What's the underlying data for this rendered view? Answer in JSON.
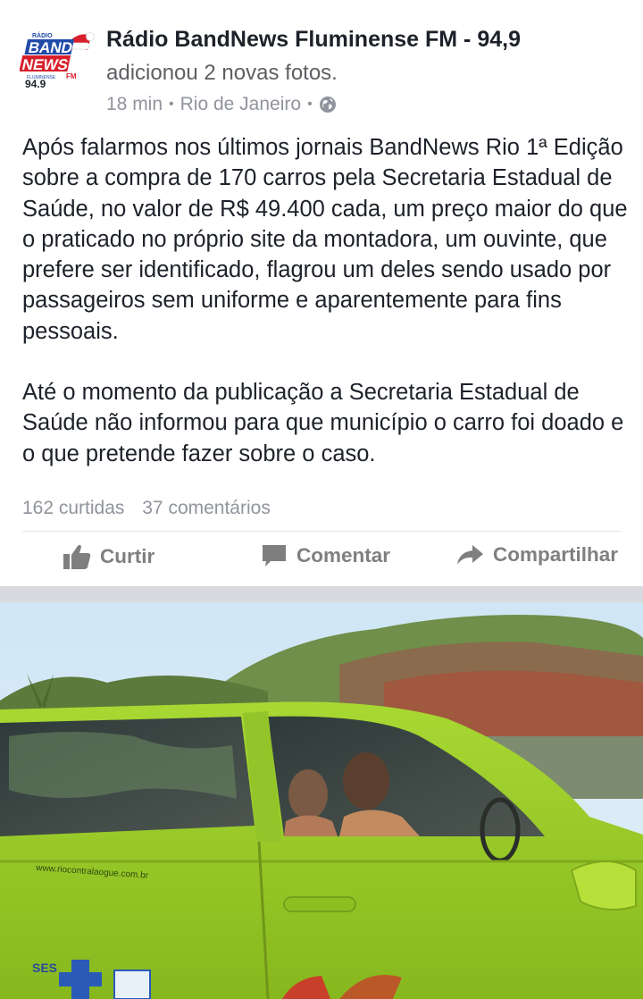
{
  "post": {
    "logo": {
      "small_text": "RÁDIO",
      "line1": "BAND",
      "line2": "NEWS",
      "fm": "FM",
      "sub": "FLUMINENSE",
      "frequency": "94.9"
    },
    "page_name": "Rádio BandNews Fluminense FM - 94,9",
    "action": "adicionou 2 novas fotos.",
    "time": "18 min",
    "location": "Rio de Janeiro",
    "privacy_icon": "globe-icon",
    "paragraphs": [
      "Após falarmos nos últimos jornais BandNews Rio 1ª Edição sobre a compra de 170 carros pela Secretaria Estadual de Saúde, no valor de R$ 49.400 cada, um preço maior do que o praticado no próprio site da montadora, um ouvinte, que prefere ser identificado, flagrou um deles sendo usado por passageiros sem uniforme e aparentemente para fins pessoais.",
      "Até o momento da publicação a Secretaria Estadual de Saúde não informou para que município o carro foi doado e o que pretende fazer sobre o caso."
    ],
    "likes": "162 curtidas",
    "comments": "37 comentários"
  },
  "actions": {
    "like": {
      "label": "Curtir",
      "icon": "thumbs-up-icon"
    },
    "comment": {
      "label": "Comentar",
      "icon": "speech-bubble-icon"
    },
    "share": {
      "label": "Compartilhar",
      "icon": "share-arrow-icon"
    }
  },
  "photo": {
    "door_text": "www.riocontralaogue.com.br",
    "badge_text": "SES"
  },
  "colors": {
    "car_green": "#9ccd2a",
    "action_gray": "#7f7f7f",
    "meta_gray": "#90949c",
    "text": "#1d2129",
    "logo_red": "#d8202c",
    "logo_blue": "#1f4aa8"
  }
}
